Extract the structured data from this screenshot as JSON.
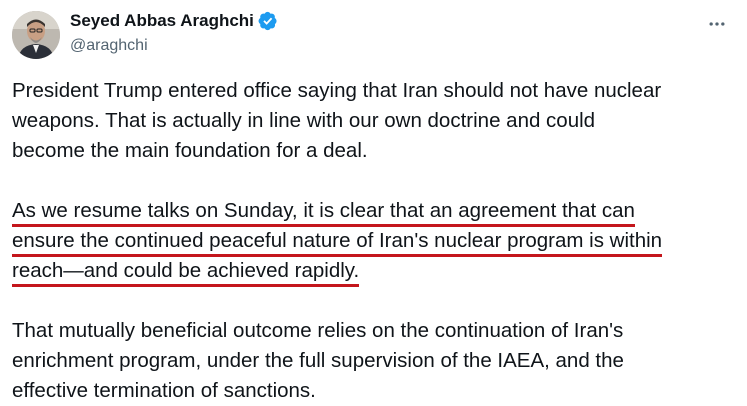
{
  "author": {
    "display_name": "Seyed Abbas Araghchi",
    "handle": "@araghchi",
    "verified": true,
    "verified_color": "#1d9bf0"
  },
  "menu": {
    "icon": "more-horizontal-icon"
  },
  "tweet": {
    "paragraph1": {
      "line1": "President Trump entered office saying that Iran should not have nuclear",
      "line2": "weapons. That is actually in line with our own doctrine and could",
      "line3": "become the main foundation for a deal."
    },
    "paragraph2": {
      "line1": "As we resume talks on Sunday, it is clear that an agreement that can",
      "line2": "ensure the continued peaceful nature of Iran's nuclear program is within",
      "line3": "reach—and could be achieved rapidly."
    },
    "paragraph3": {
      "line1": "That mutually beneficial outcome relies on the continuation of Iran's",
      "line2": "enrichment program, under the full supervision of the IAEA, and the",
      "line3": "effective termination of sanctions."
    },
    "highlight_color": "#c4161c"
  }
}
